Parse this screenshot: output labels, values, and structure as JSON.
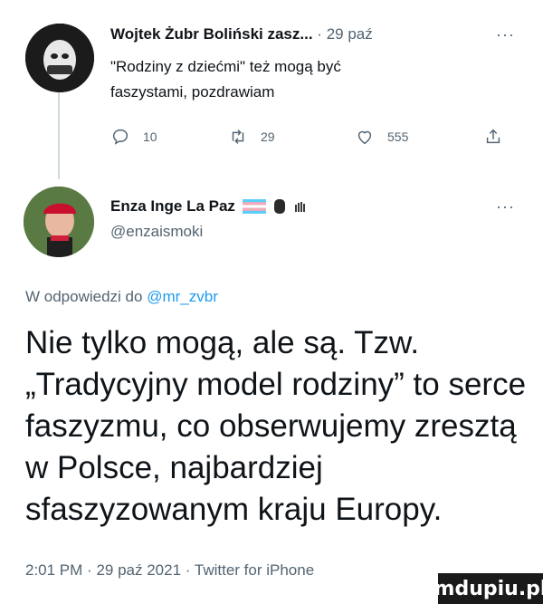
{
  "tweet1": {
    "author_name": "Wojtek Żubr Boliński zasz...",
    "separator": "·",
    "date": "29 paź",
    "more": "···",
    "text_line1": "\"Rodziny z dziećmi\" też mogą być",
    "text_line2": "faszystami, pozdrawiam",
    "replies": "10",
    "retweets": "29",
    "likes": "555",
    "icons": [
      "reply-icon",
      "retweet-icon",
      "like-icon",
      "share-icon"
    ]
  },
  "tweet2": {
    "author_name": "Enza Inge La Paz",
    "handle": "@enzaismoki",
    "more": "···",
    "badges": [
      "trans-flag-emoji",
      "fist-emoji",
      "sign-language-emoji"
    ]
  },
  "reply_to": {
    "prefix": "W odpowiedzi do",
    "user": "@mr_zvbr"
  },
  "main_text": "Nie tylko mogą, ale są. Tzw. „Tradycyjny model rodziny” to serce faszyzmu, co obserwujemy zresztą w Polsce, najbardziej sfaszyzowanym kraju Europy.",
  "footer": {
    "time": "2:01 PM",
    "sep1": "·",
    "date": "29 paź 2021",
    "sep2": "·",
    "app": "Twitter for iPhone"
  },
  "watermark": "mdupiu.pl",
  "colors": {
    "text": "#0f1419",
    "muted": "#536471",
    "link": "#1d9bf0",
    "thread_line": "#cfd9de"
  }
}
